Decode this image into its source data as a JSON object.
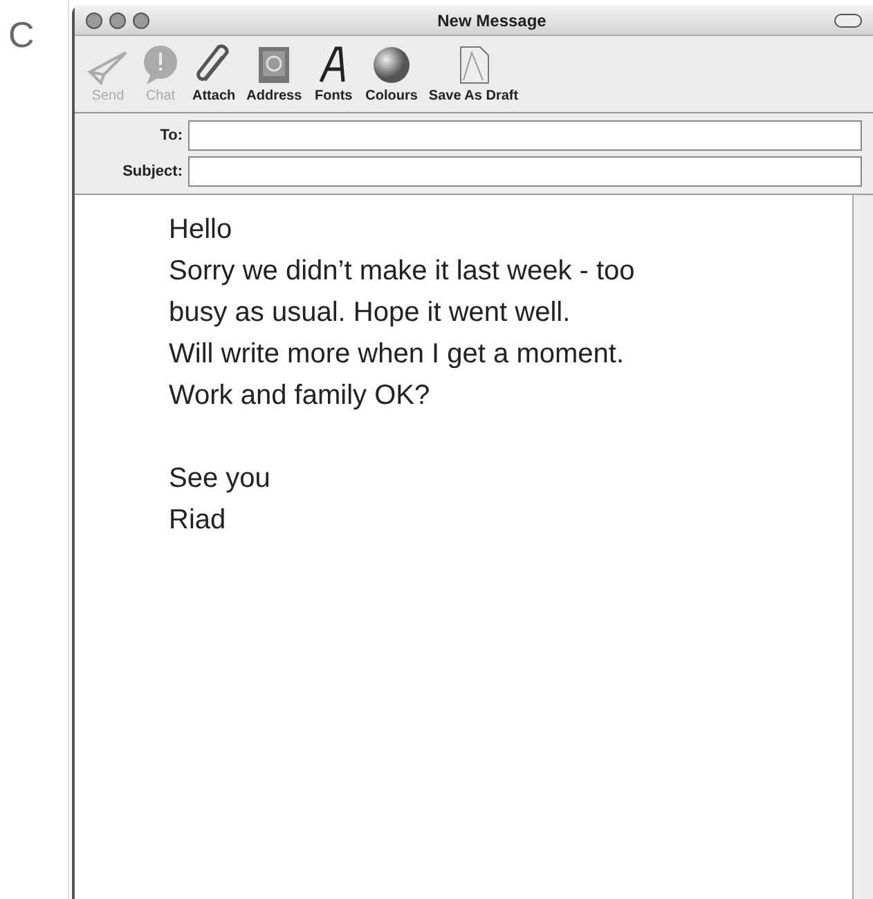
{
  "figure_label": "C",
  "window": {
    "title": "New Message"
  },
  "toolbar": [
    {
      "label": "Send",
      "kind": "send",
      "disabled": true
    },
    {
      "label": "Chat",
      "kind": "chat",
      "disabled": true
    },
    {
      "label": "Attach",
      "kind": "attach",
      "disabled": false
    },
    {
      "label": "Address",
      "kind": "address",
      "disabled": false
    },
    {
      "label": "Fonts",
      "kind": "fonts",
      "disabled": false
    },
    {
      "label": "Colours",
      "kind": "colours",
      "disabled": false
    },
    {
      "label": "Save As Draft",
      "kind": "draft",
      "disabled": false
    }
  ],
  "fields": [
    {
      "label": "To:"
    },
    {
      "label": "Subject:"
    }
  ],
  "body": [
    {
      "lines": [
        "Hello",
        "Sorry we didn’t make it last week - too",
        "busy as usual. Hope it went well.",
        "Will write more when I get a moment.",
        "Work and family OK?"
      ]
    },
    {
      "lines": [
        "See you",
        "Riad"
      ]
    }
  ]
}
